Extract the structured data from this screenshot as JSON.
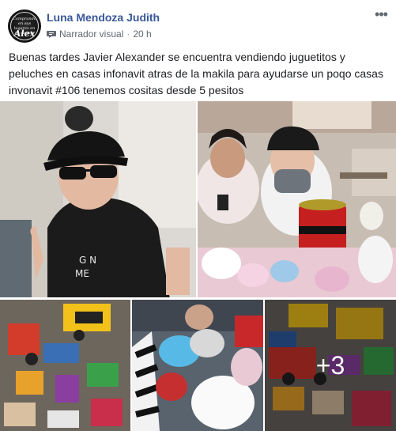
{
  "post": {
    "author": "Luna Mendoza Judith",
    "avatar_text_top": "Comprando en sus lugares en su mundo",
    "avatar_text_name": "Alex",
    "narrator_label": "Narrador visual",
    "separator": "·",
    "timestamp": "20 h",
    "more_icon": "•••",
    "text": "Buenas tardes Javier Alexander se encuentra vendiendo juguetitos y peluches en casas infonavit atras de la makila para ayudarse un poqo casas invonavit #106 tenemos cositas desde 5 pesitos"
  },
  "photos": {
    "extra_count": "+3"
  },
  "colors": {
    "author": "#385898",
    "meta": "#616770",
    "text": "#1c1e21"
  },
  "icons": [
    "narrator-icon",
    "more-options-icon"
  ]
}
